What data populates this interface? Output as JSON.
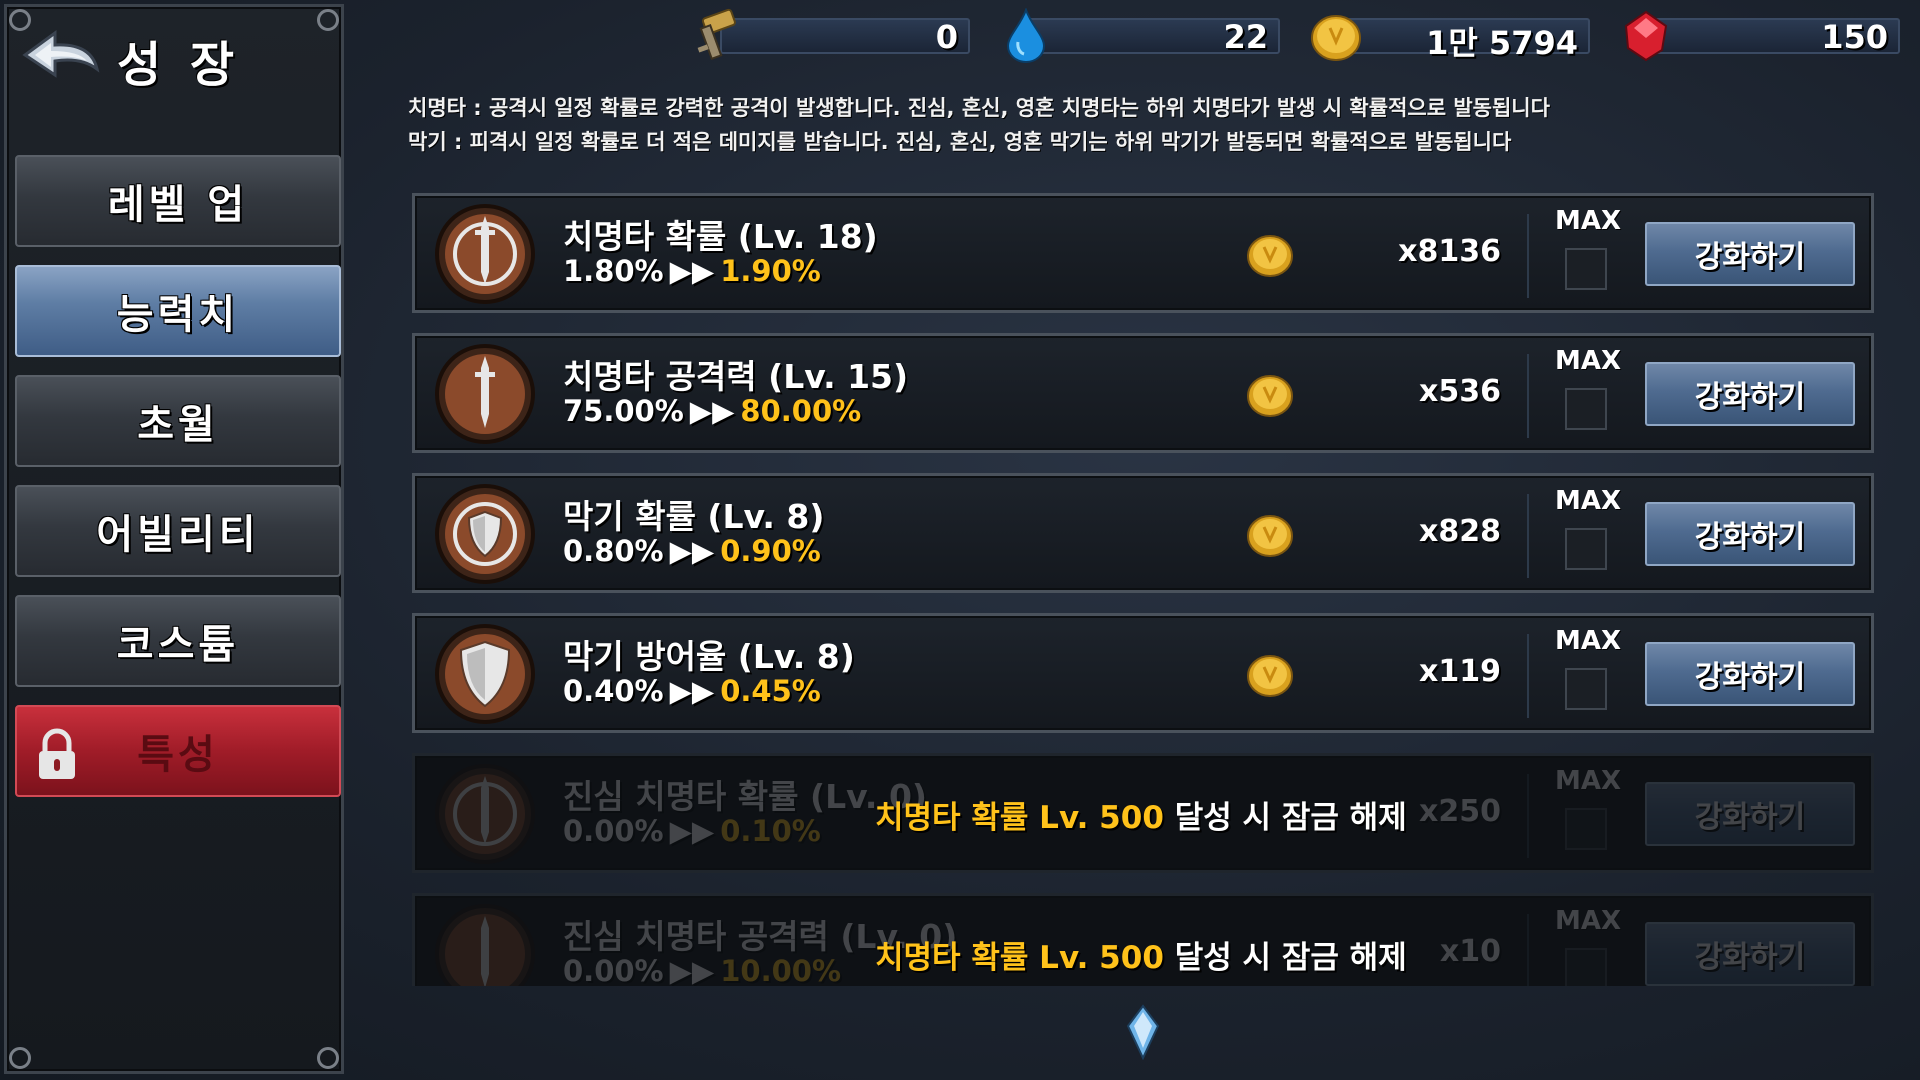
{
  "sidebar": {
    "title": "성 장",
    "menu": [
      {
        "label": "레벨 업",
        "state": "normal"
      },
      {
        "label": "능력치",
        "state": "active"
      },
      {
        "label": "초월",
        "state": "normal"
      },
      {
        "label": "어빌리티",
        "state": "normal"
      },
      {
        "label": "코스튬",
        "state": "normal"
      },
      {
        "label": "특성",
        "state": "locked"
      }
    ]
  },
  "currencies": [
    {
      "icon": "key-icon",
      "value": "0"
    },
    {
      "icon": "water-drop-icon",
      "value": "22"
    },
    {
      "icon": "gold-coin-icon",
      "value": "1만 5794"
    },
    {
      "icon": "red-gem-icon",
      "value": "150"
    }
  ],
  "description": {
    "line1": "치명타 : 공격시 일정 확률로 강력한 공격이 발생합니다. 진심, 혼신, 영혼 치명타는 하위 치명타가 발생 시 확률적으로 발동됩니다",
    "line2": "막기 : 피격시 일정 확률로 더 적은 데미지를 받습니다. 진심, 혼신, 영혼 막기는 하위 막기가 발동되면 확률적으로 발동됩니다"
  },
  "stats": [
    {
      "name": "치명타 확률 (Lv. 18)",
      "current": "1.80%",
      "arrows": "▶▶",
      "next": "1.90%",
      "cost": "x8136",
      "max_label": "MAX",
      "button": "강화하기",
      "emblem": "sword-ring-emblem-icon",
      "locked": false
    },
    {
      "name": "치명타 공격력 (Lv. 15)",
      "current": "75.00%",
      "arrows": "▶▶",
      "next": "80.00%",
      "cost": "x536",
      "max_label": "MAX",
      "button": "강화하기",
      "emblem": "sword-emblem-icon",
      "locked": false
    },
    {
      "name": "막기 확률 (Lv. 8)",
      "current": "0.80%",
      "arrows": "▶▶",
      "next": "0.90%",
      "cost": "x828",
      "max_label": "MAX",
      "button": "강화하기",
      "emblem": "shield-ring-emblem-icon",
      "locked": false
    },
    {
      "name": "막기 방어율 (Lv. 8)",
      "current": "0.40%",
      "arrows": "▶▶",
      "next": "0.45%",
      "cost": "x119",
      "max_label": "MAX",
      "button": "강화하기",
      "emblem": "shield-emblem-icon",
      "locked": false
    },
    {
      "name": "진심 치명타 확률 (Lv. 0)",
      "current": "0.00%",
      "arrows": "▶▶",
      "next": "0.10%",
      "cost": "x250",
      "max_label": "MAX",
      "button": "강화하기",
      "emblem": "sword-ring-emblem-icon",
      "locked": true,
      "unlock_highlight": "치명타 확률 Lv. 500",
      "unlock_rest": " 달성 시 잠금 해제"
    },
    {
      "name": "진심 치명타 공격력 (Lv. 0)",
      "current": "0.00%",
      "arrows": "▶▶",
      "next": "10.00%",
      "cost": "x10",
      "max_label": "MAX",
      "button": "강화하기",
      "emblem": "sword-emblem-icon",
      "locked": true,
      "unlock_highlight": "치명타 확률 Lv. 500",
      "unlock_rest": " 달성 시 잠금 해제"
    }
  ]
}
